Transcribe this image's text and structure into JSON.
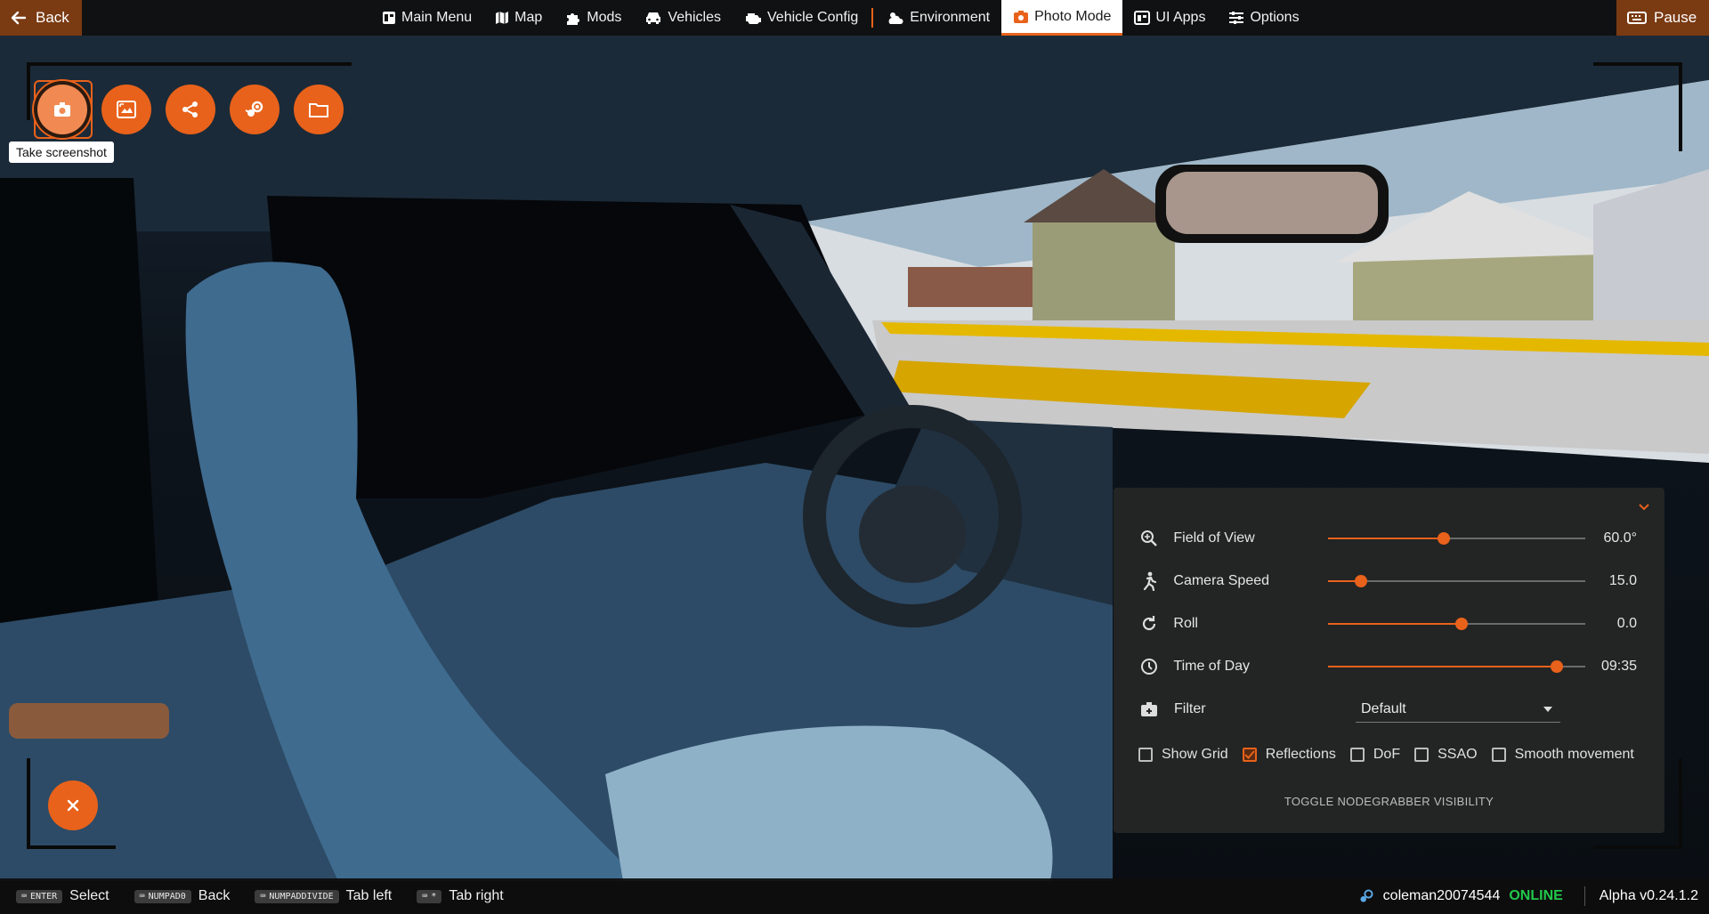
{
  "topbar": {
    "back_label": "Back",
    "pause_label": "Pause",
    "nav": [
      {
        "label": "Main Menu",
        "icon": "main-menu-icon"
      },
      {
        "label": "Map",
        "icon": "map-icon"
      },
      {
        "label": "Mods",
        "icon": "puzzle-icon"
      },
      {
        "label": "Vehicles",
        "icon": "car-icon"
      },
      {
        "label": "Vehicle Config",
        "icon": "engine-icon"
      },
      {
        "label": "Environment",
        "icon": "weather-icon"
      },
      {
        "label": "Photo Mode",
        "icon": "camera-icon",
        "active": true
      },
      {
        "label": "UI Apps",
        "icon": "ui-apps-icon"
      },
      {
        "label": "Options",
        "icon": "sliders-icon"
      }
    ]
  },
  "photo_tools": {
    "buttons": [
      "camera-icon",
      "fullscreen-icon",
      "share-icon",
      "steam-icon",
      "folder-icon"
    ],
    "tooltip": "Take screenshot"
  },
  "settings": {
    "fov": {
      "label": "Field of View",
      "value": "60.0°",
      "level": 0.45
    },
    "speed": {
      "label": "Camera Speed",
      "value": "15.0",
      "level": 0.13
    },
    "roll": {
      "label": "Roll",
      "value": "0.0",
      "level": 0.52
    },
    "time": {
      "label": "Time of Day",
      "value": "09:35",
      "level": 0.89
    },
    "filter": {
      "label": "Filter",
      "value": "Default"
    },
    "checks": [
      {
        "label": "Show Grid",
        "checked": false
      },
      {
        "label": "Reflections",
        "checked": true
      },
      {
        "label": "DoF",
        "checked": false
      },
      {
        "label": "SSAO",
        "checked": false
      },
      {
        "label": "Smooth movement",
        "checked": false
      }
    ],
    "toggle_label": "TOGGLE NODEGRABBER VISIBILITY"
  },
  "bottombar": {
    "hints": [
      {
        "key": "ENTER",
        "label": "Select"
      },
      {
        "key": "NUMPAD0",
        "label": "Back"
      },
      {
        "key": "NUMPADDIVIDE",
        "label": "Tab left"
      },
      {
        "key": "*",
        "label": "Tab right"
      }
    ],
    "username": "coleman20074544",
    "status": "ONLINE",
    "version": "Alpha v0.24.1.2"
  },
  "colors": {
    "accent": "#e8621b",
    "online": "#22c84a",
    "panel": "#262626"
  }
}
